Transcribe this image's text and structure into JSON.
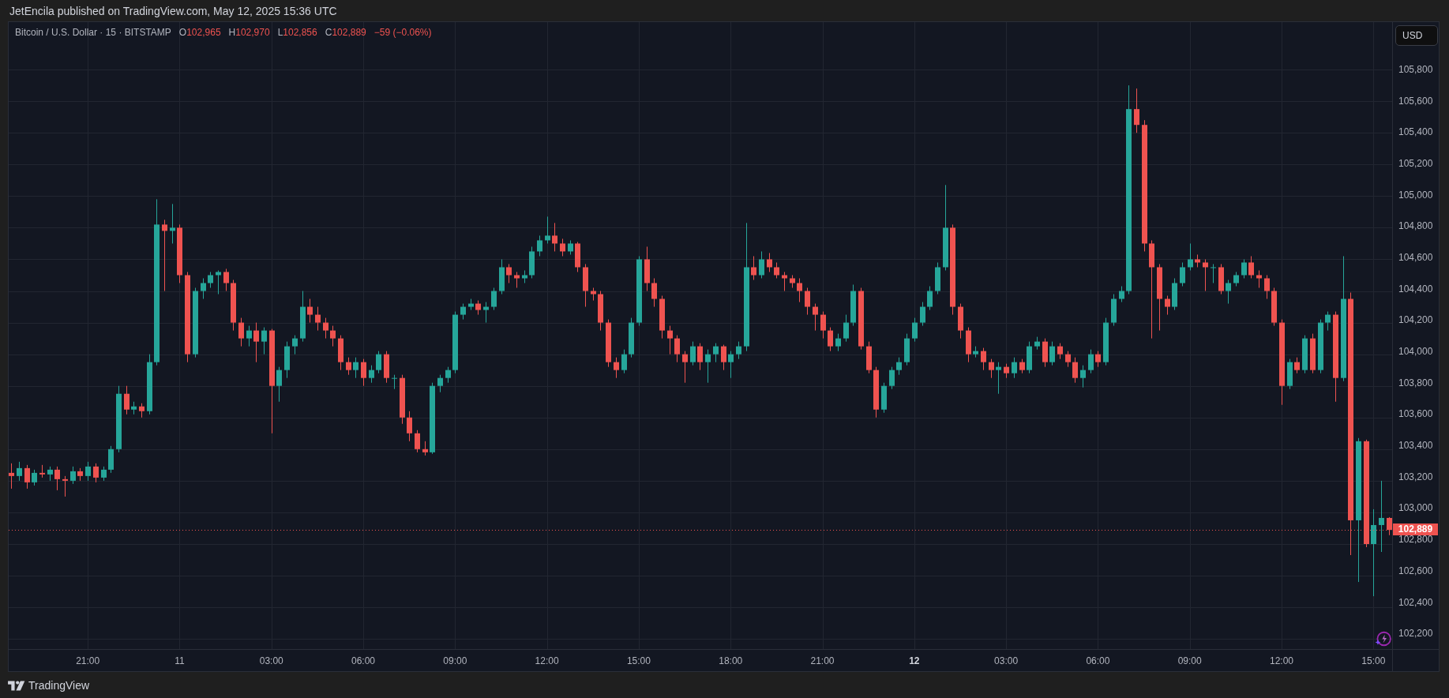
{
  "publish_note": "JetEncila published on TradingView.com, May 12, 2025 15:36 UTC",
  "legend": {
    "symbol": "Bitcoin / U.S. Dollar · 15 · BITSTAMP",
    "ohlc": [
      {
        "label": "O",
        "value": "102,965"
      },
      {
        "label": "H",
        "value": "102,970"
      },
      {
        "label": "L",
        "value": "102,856"
      },
      {
        "label": "C",
        "value": "102,889"
      }
    ],
    "change": "−59 (−0.06%)"
  },
  "currency_button": "USD",
  "current_price": "102,889",
  "xtick_styles": [
    {
      "bold": false
    },
    {
      "bold": false
    },
    {
      "bold": false
    },
    {
      "bold": false
    },
    {
      "bold": false
    },
    {
      "bold": false
    },
    {
      "bold": false
    },
    {
      "bold": false
    },
    {
      "bold": false
    },
    {
      "bold": true
    },
    {
      "bold": false
    },
    {
      "bold": false
    },
    {
      "bold": false
    },
    {
      "bold": false
    },
    {
      "bold": false
    }
  ],
  "chart_data": {
    "type": "candlestick",
    "grid": true,
    "xlim": [
      "2025-05-10 18:25",
      "2025-05-12 17:11"
    ],
    "ref_lines": [
      {
        "axis": "y",
        "value": 102889,
        "color": "#ef5350"
      }
    ],
    "ylim": [
      102136,
      106100
    ],
    "yticks": [
      {
        "value": 105800,
        "label": "105,800"
      },
      {
        "value": 105600,
        "label": "105,600"
      },
      {
        "value": 105400,
        "label": "105,400"
      },
      {
        "value": 105200,
        "label": "105,200"
      },
      {
        "value": 105000,
        "label": "105,000"
      },
      {
        "value": 104800,
        "label": "104,800"
      },
      {
        "value": 104600,
        "label": "104,600"
      },
      {
        "value": 104400,
        "label": "104,400"
      },
      {
        "value": 104200,
        "label": "104,200"
      },
      {
        "value": 104000,
        "label": "104,000"
      },
      {
        "value": 103800,
        "label": "103,800"
      },
      {
        "value": 103600,
        "label": "103,600"
      },
      {
        "value": 103400,
        "label": "103,400"
      },
      {
        "value": 103200,
        "label": "103,200"
      },
      {
        "value": 103000,
        "label": "103,000"
      },
      {
        "value": 102800,
        "label": "102,800"
      },
      {
        "value": 102600,
        "label": "102,600"
      },
      {
        "value": 102400,
        "label": "102,400"
      },
      {
        "value": 102200,
        "label": "102,200"
      }
    ],
    "xticks": [
      {
        "value": "2025-05-10 21:00",
        "label": "21:00"
      },
      {
        "value": "2025-05-11 00:00",
        "label": "11"
      },
      {
        "value": "2025-05-11 03:00",
        "label": "03:00"
      },
      {
        "value": "2025-05-11 06:00",
        "label": "06:00"
      },
      {
        "value": "2025-05-11 09:00",
        "label": "09:00"
      },
      {
        "value": "2025-05-11 12:00",
        "label": "12:00"
      },
      {
        "value": "2025-05-11 15:00",
        "label": "15:00"
      },
      {
        "value": "2025-05-11 18:00",
        "label": "18:00"
      },
      {
        "value": "2025-05-11 21:00",
        "label": "21:00"
      },
      {
        "value": "2025-05-12 00:00",
        "label": "12"
      },
      {
        "value": "2025-05-12 03:00",
        "label": "03:00"
      },
      {
        "value": "2025-05-12 06:00",
        "label": "06:00"
      },
      {
        "value": "2025-05-12 09:00",
        "label": "09:00"
      },
      {
        "value": "2025-05-12 12:00",
        "label": "12:00"
      },
      {
        "value": "2025-05-12 15:00",
        "label": "15:00"
      }
    ],
    "x": [
      "2025-05-10 18:30",
      "2025-05-10 18:45",
      "2025-05-10 19:00",
      "2025-05-10 19:15",
      "2025-05-10 19:30",
      "2025-05-10 19:45",
      "2025-05-10 20:00",
      "2025-05-10 20:15",
      "2025-05-10 20:30",
      "2025-05-10 20:45",
      "2025-05-10 21:00",
      "2025-05-10 21:15",
      "2025-05-10 21:30",
      "2025-05-10 21:45",
      "2025-05-10 22:00",
      "2025-05-10 22:15",
      "2025-05-10 22:30",
      "2025-05-10 22:45",
      "2025-05-10 23:00",
      "2025-05-10 23:15",
      "2025-05-10 23:30",
      "2025-05-10 23:45",
      "2025-05-11 00:00",
      "2025-05-11 00:15",
      "2025-05-11 00:30",
      "2025-05-11 00:45",
      "2025-05-11 01:00",
      "2025-05-11 01:15",
      "2025-05-11 01:30",
      "2025-05-11 01:45",
      "2025-05-11 02:00",
      "2025-05-11 02:15",
      "2025-05-11 02:30",
      "2025-05-11 02:45",
      "2025-05-11 03:00",
      "2025-05-11 03:15",
      "2025-05-11 03:30",
      "2025-05-11 03:45",
      "2025-05-11 04:00",
      "2025-05-11 04:15",
      "2025-05-11 04:30",
      "2025-05-11 04:45",
      "2025-05-11 05:00",
      "2025-05-11 05:15",
      "2025-05-11 05:30",
      "2025-05-11 05:45",
      "2025-05-11 06:00",
      "2025-05-11 06:15",
      "2025-05-11 06:30",
      "2025-05-11 06:45",
      "2025-05-11 07:00",
      "2025-05-11 07:15",
      "2025-05-11 07:30",
      "2025-05-11 07:45",
      "2025-05-11 08:00",
      "2025-05-11 08:15",
      "2025-05-11 08:30",
      "2025-05-11 08:45",
      "2025-05-11 09:00",
      "2025-05-11 09:15",
      "2025-05-11 09:30",
      "2025-05-11 09:45",
      "2025-05-11 10:00",
      "2025-05-11 10:15",
      "2025-05-11 10:30",
      "2025-05-11 10:45",
      "2025-05-11 11:00",
      "2025-05-11 11:15",
      "2025-05-11 11:30",
      "2025-05-11 11:45",
      "2025-05-11 12:00",
      "2025-05-11 12:15",
      "2025-05-11 12:30",
      "2025-05-11 12:45",
      "2025-05-11 13:00",
      "2025-05-11 13:15",
      "2025-05-11 13:30",
      "2025-05-11 13:45",
      "2025-05-11 14:00",
      "2025-05-11 14:15",
      "2025-05-11 14:30",
      "2025-05-11 14:45",
      "2025-05-11 15:00",
      "2025-05-11 15:15",
      "2025-05-11 15:30",
      "2025-05-11 15:45",
      "2025-05-11 16:00",
      "2025-05-11 16:15",
      "2025-05-11 16:30",
      "2025-05-11 16:45",
      "2025-05-11 17:00",
      "2025-05-11 17:15",
      "2025-05-11 17:30",
      "2025-05-11 17:45",
      "2025-05-11 18:00",
      "2025-05-11 18:15",
      "2025-05-11 18:30",
      "2025-05-11 18:45",
      "2025-05-11 19:00",
      "2025-05-11 19:15",
      "2025-05-11 19:30",
      "2025-05-11 19:45",
      "2025-05-11 20:00",
      "2025-05-11 20:15",
      "2025-05-11 20:30",
      "2025-05-11 20:45",
      "2025-05-11 21:00",
      "2025-05-11 21:15",
      "2025-05-11 21:30",
      "2025-05-11 21:45",
      "2025-05-11 22:00",
      "2025-05-11 22:15",
      "2025-05-11 22:30",
      "2025-05-11 22:45",
      "2025-05-11 23:00",
      "2025-05-11 23:15",
      "2025-05-11 23:30",
      "2025-05-11 23:45",
      "2025-05-12 00:00",
      "2025-05-12 00:15",
      "2025-05-12 00:30",
      "2025-05-12 00:45",
      "2025-05-12 01:00",
      "2025-05-12 01:15",
      "2025-05-12 01:30",
      "2025-05-12 01:45",
      "2025-05-12 02:00",
      "2025-05-12 02:15",
      "2025-05-12 02:30",
      "2025-05-12 02:45",
      "2025-05-12 03:00",
      "2025-05-12 03:15",
      "2025-05-12 03:30",
      "2025-05-12 03:45",
      "2025-05-12 04:00",
      "2025-05-12 04:15",
      "2025-05-12 04:30",
      "2025-05-12 04:45",
      "2025-05-12 05:00",
      "2025-05-12 05:15",
      "2025-05-12 05:30",
      "2025-05-12 05:45",
      "2025-05-12 06:00",
      "2025-05-12 06:15",
      "2025-05-12 06:30",
      "2025-05-12 06:45",
      "2025-05-12 07:00",
      "2025-05-12 07:15",
      "2025-05-12 07:30",
      "2025-05-12 07:45",
      "2025-05-12 08:00",
      "2025-05-12 08:15",
      "2025-05-12 08:30",
      "2025-05-12 08:45",
      "2025-05-12 09:00",
      "2025-05-12 09:15",
      "2025-05-12 09:30",
      "2025-05-12 09:45",
      "2025-05-12 10:00",
      "2025-05-12 10:15",
      "2025-05-12 10:30",
      "2025-05-12 10:45",
      "2025-05-12 11:00",
      "2025-05-12 11:15",
      "2025-05-12 11:30",
      "2025-05-12 11:45",
      "2025-05-12 12:00",
      "2025-05-12 12:15",
      "2025-05-12 12:30",
      "2025-05-12 12:45",
      "2025-05-12 13:00",
      "2025-05-12 13:15",
      "2025-05-12 13:30",
      "2025-05-12 13:45",
      "2025-05-12 14:00",
      "2025-05-12 14:15",
      "2025-05-12 14:30",
      "2025-05-12 14:45",
      "2025-05-12 15:00",
      "2025-05-12 15:15",
      "2025-05-12 15:30"
    ],
    "ohlc": [
      [
        103250,
        103310,
        103150,
        103230
      ],
      [
        103230,
        103320,
        103200,
        103280
      ],
      [
        103280,
        103300,
        103150,
        103190
      ],
      [
        103190,
        103270,
        103170,
        103250
      ],
      [
        103250,
        103300,
        103220,
        103240
      ],
      [
        103240,
        103290,
        103200,
        103270
      ],
      [
        103270,
        103290,
        103140,
        103210
      ],
      [
        103210,
        103230,
        103100,
        103200
      ],
      [
        103200,
        103290,
        103180,
        103260
      ],
      [
        103260,
        103280,
        103200,
        103230
      ],
      [
        103230,
        103320,
        103200,
        103290
      ],
      [
        103290,
        103310,
        103190,
        103220
      ],
      [
        103220,
        103290,
        103200,
        103270
      ],
      [
        103270,
        103420,
        103250,
        103400
      ],
      [
        103400,
        103800,
        103380,
        103750
      ],
      [
        103750,
        103800,
        103620,
        103650
      ],
      [
        103650,
        103700,
        103620,
        103670
      ],
      [
        103670,
        103690,
        103600,
        103640
      ],
      [
        103640,
        104000,
        103620,
        103950
      ],
      [
        103950,
        104980,
        103930,
        104820
      ],
      [
        104820,
        104850,
        104400,
        104780
      ],
      [
        104780,
        104950,
        104700,
        104800
      ],
      [
        104800,
        104820,
        104450,
        104500
      ],
      [
        104500,
        104520,
        103950,
        104000
      ],
      [
        104000,
        104420,
        103980,
        104400
      ],
      [
        104400,
        104480,
        104350,
        104450
      ],
      [
        104450,
        104520,
        104420,
        104500
      ],
      [
        104500,
        104530,
        104380,
        104520
      ],
      [
        104520,
        104540,
        104400,
        104450
      ],
      [
        104450,
        104470,
        104150,
        104200
      ],
      [
        104200,
        104230,
        104050,
        104100
      ],
      [
        104100,
        104180,
        104050,
        104150
      ],
      [
        104150,
        104200,
        103950,
        104080
      ],
      [
        104080,
        104170,
        104000,
        104150
      ],
      [
        104150,
        104160,
        103500,
        103800
      ],
      [
        103800,
        103920,
        103700,
        103900
      ],
      [
        103900,
        104080,
        103850,
        104050
      ],
      [
        104050,
        104120,
        104000,
        104100
      ],
      [
        104100,
        104400,
        104080,
        104300
      ],
      [
        104300,
        104350,
        104200,
        104250
      ],
      [
        104250,
        104300,
        104150,
        104200
      ],
      [
        104200,
        104230,
        104100,
        104150
      ],
      [
        104150,
        104180,
        104050,
        104100
      ],
      [
        104100,
        104120,
        103900,
        103950
      ],
      [
        103950,
        103980,
        103870,
        103900
      ],
      [
        103900,
        103980,
        103850,
        103950
      ],
      [
        103950,
        103970,
        103800,
        103850
      ],
      [
        103850,
        103930,
        103820,
        103900
      ],
      [
        103900,
        104020,
        103880,
        104000
      ],
      [
        104000,
        104020,
        103820,
        103850
      ],
      [
        103850,
        103870,
        103780,
        103850
      ],
      [
        103850,
        103870,
        103560,
        103600
      ],
      [
        103600,
        103640,
        103450,
        103500
      ],
      [
        103500,
        103520,
        103380,
        103400
      ],
      [
        103400,
        103450,
        103360,
        103380
      ],
      [
        103380,
        103820,
        103370,
        103800
      ],
      [
        103800,
        103870,
        103760,
        103850
      ],
      [
        103850,
        103920,
        103820,
        103900
      ],
      [
        103900,
        104270,
        103880,
        104250
      ],
      [
        104250,
        104320,
        104220,
        104300
      ],
      [
        104300,
        104350,
        104280,
        104320
      ],
      [
        104320,
        104340,
        104250,
        104280
      ],
      [
        104280,
        104330,
        104200,
        104300
      ],
      [
        104300,
        104420,
        104280,
        104400
      ],
      [
        104400,
        104600,
        104380,
        104550
      ],
      [
        104550,
        104570,
        104450,
        104500
      ],
      [
        104500,
        104520,
        104420,
        104480
      ],
      [
        104480,
        104530,
        104450,
        104500
      ],
      [
        104500,
        104680,
        104480,
        104650
      ],
      [
        104650,
        104750,
        104620,
        104720
      ],
      [
        104720,
        104870,
        104700,
        104750
      ],
      [
        104750,
        104830,
        104650,
        104700
      ],
      [
        104700,
        104730,
        104620,
        104650
      ],
      [
        104650,
        104720,
        104630,
        104700
      ],
      [
        104700,
        104710,
        104520,
        104550
      ],
      [
        104550,
        104570,
        104300,
        104400
      ],
      [
        104400,
        104420,
        104340,
        104380
      ],
      [
        104380,
        104400,
        104150,
        104200
      ],
      [
        104200,
        104220,
        103920,
        103950
      ],
      [
        103950,
        103980,
        103850,
        103900
      ],
      [
        103900,
        104030,
        103880,
        104000
      ],
      [
        104000,
        104230,
        103980,
        104200
      ],
      [
        104200,
        104620,
        104180,
        104600
      ],
      [
        104600,
        104680,
        104400,
        104450
      ],
      [
        104450,
        104480,
        104300,
        104350
      ],
      [
        104350,
        104370,
        104100,
        104150
      ],
      [
        104150,
        104180,
        104000,
        104100
      ],
      [
        104100,
        104120,
        103950,
        104000
      ],
      [
        104000,
        104020,
        103820,
        103950
      ],
      [
        103950,
        104080,
        103930,
        104050
      ],
      [
        104050,
        104070,
        103900,
        103950
      ],
      [
        103950,
        104030,
        103820,
        104000
      ],
      [
        104000,
        104070,
        103950,
        104050
      ],
      [
        104050,
        104060,
        103900,
        103950
      ],
      [
        103950,
        104020,
        103850,
        104000
      ],
      [
        104000,
        104080,
        103970,
        104050
      ],
      [
        104050,
        104830,
        104020,
        104550
      ],
      [
        104550,
        104620,
        104470,
        104500
      ],
      [
        104500,
        104650,
        104480,
        104600
      ],
      [
        104600,
        104640,
        104520,
        104550
      ],
      [
        104550,
        104580,
        104480,
        104500
      ],
      [
        104500,
        104520,
        104400,
        104480
      ],
      [
        104480,
        104500,
        104420,
        104450
      ],
      [
        104450,
        104480,
        104330,
        104400
      ],
      [
        104400,
        104420,
        104250,
        104300
      ],
      [
        104300,
        104320,
        104150,
        104250
      ],
      [
        104250,
        104270,
        104100,
        104150
      ],
      [
        104150,
        104170,
        104020,
        104050
      ],
      [
        104050,
        104130,
        104020,
        104100
      ],
      [
        104100,
        104250,
        104080,
        104200
      ],
      [
        104200,
        104440,
        104180,
        104400
      ],
      [
        104400,
        104420,
        104030,
        104050
      ],
      [
        104050,
        104080,
        103880,
        103900
      ],
      [
        103900,
        103920,
        103600,
        103650
      ],
      [
        103650,
        103820,
        103630,
        103800
      ],
      [
        103800,
        103920,
        103780,
        103900
      ],
      [
        103900,
        103980,
        103870,
        103950
      ],
      [
        103950,
        104130,
        103930,
        104100
      ],
      [
        104100,
        104230,
        104080,
        104200
      ],
      [
        104200,
        104330,
        104180,
        104300
      ],
      [
        104300,
        104430,
        104280,
        104400
      ],
      [
        104400,
        104580,
        104380,
        104550
      ],
      [
        104550,
        105070,
        104530,
        104800
      ],
      [
        104800,
        104820,
        104250,
        104300
      ],
      [
        104300,
        104320,
        104100,
        104150
      ],
      [
        104150,
        104170,
        103950,
        104000
      ],
      [
        104000,
        104050,
        103980,
        104020
      ],
      [
        104020,
        104040,
        103900,
        103950
      ],
      [
        103950,
        103970,
        103850,
        103900
      ],
      [
        103900,
        103950,
        103750,
        103920
      ],
      [
        103920,
        103940,
        103850,
        103880
      ],
      [
        103880,
        103980,
        103850,
        103950
      ],
      [
        103950,
        103970,
        103880,
        103900
      ],
      [
        103900,
        104080,
        103880,
        104050
      ],
      [
        104050,
        104110,
        104030,
        104080
      ],
      [
        104080,
        104100,
        103920,
        103950
      ],
      [
        103950,
        104080,
        103930,
        104050
      ],
      [
        104050,
        104070,
        103970,
        104000
      ],
      [
        104000,
        104020,
        103920,
        103950
      ],
      [
        103950,
        103980,
        103820,
        103850
      ],
      [
        103850,
        103930,
        103790,
        103900
      ],
      [
        103900,
        104030,
        103880,
        104000
      ],
      [
        104000,
        104020,
        103920,
        103950
      ],
      [
        103950,
        104230,
        103930,
        104200
      ],
      [
        104200,
        104380,
        104180,
        104350
      ],
      [
        104350,
        104430,
        104330,
        104400
      ],
      [
        104400,
        105700,
        104380,
        105550
      ],
      [
        105550,
        105680,
        105400,
        105450
      ],
      [
        105450,
        105480,
        104650,
        104700
      ],
      [
        104700,
        104720,
        104100,
        104550
      ],
      [
        104550,
        104570,
        104150,
        104350
      ],
      [
        104350,
        104370,
        104250,
        104300
      ],
      [
        104300,
        104480,
        104280,
        104450
      ],
      [
        104450,
        104580,
        104430,
        104550
      ],
      [
        104550,
        104700,
        104530,
        104600
      ],
      [
        104600,
        104630,
        104550,
        104580
      ],
      [
        104580,
        104600,
        104400,
        104550
      ],
      [
        104550,
        104570,
        104450,
        104550
      ],
      [
        104550,
        104570,
        104380,
        104400
      ],
      [
        104400,
        104470,
        104320,
        104450
      ],
      [
        104450,
        104520,
        104430,
        104500
      ],
      [
        104500,
        104600,
        104480,
        104580
      ],
      [
        104580,
        104620,
        104480,
        104500
      ],
      [
        104500,
        104530,
        104420,
        104480
      ],
      [
        104480,
        104500,
        104350,
        104400
      ],
      [
        104400,
        104420,
        104180,
        104200
      ],
      [
        104200,
        104220,
        103680,
        103800
      ],
      [
        103800,
        103970,
        103780,
        103950
      ],
      [
        103950,
        103980,
        103880,
        103900
      ],
      [
        103900,
        104120,
        103880,
        104100
      ],
      [
        104100,
        104130,
        103880,
        103900
      ],
      [
        103900,
        104220,
        103880,
        104200
      ],
      [
        104200,
        104270,
        104150,
        104250
      ],
      [
        104250,
        104270,
        103700,
        103850
      ],
      [
        103850,
        104620,
        103830,
        104350
      ],
      [
        104350,
        104390,
        102730,
        102950
      ],
      [
        102950,
        103470,
        102560,
        103450
      ],
      [
        103450,
        103460,
        102780,
        102800
      ],
      [
        102800,
        103020,
        102470,
        102920
      ],
      [
        102920,
        103200,
        102750,
        102965
      ],
      [
        102965,
        102970,
        102856,
        102889
      ]
    ]
  },
  "footer": {
    "brand": "TradingView"
  }
}
